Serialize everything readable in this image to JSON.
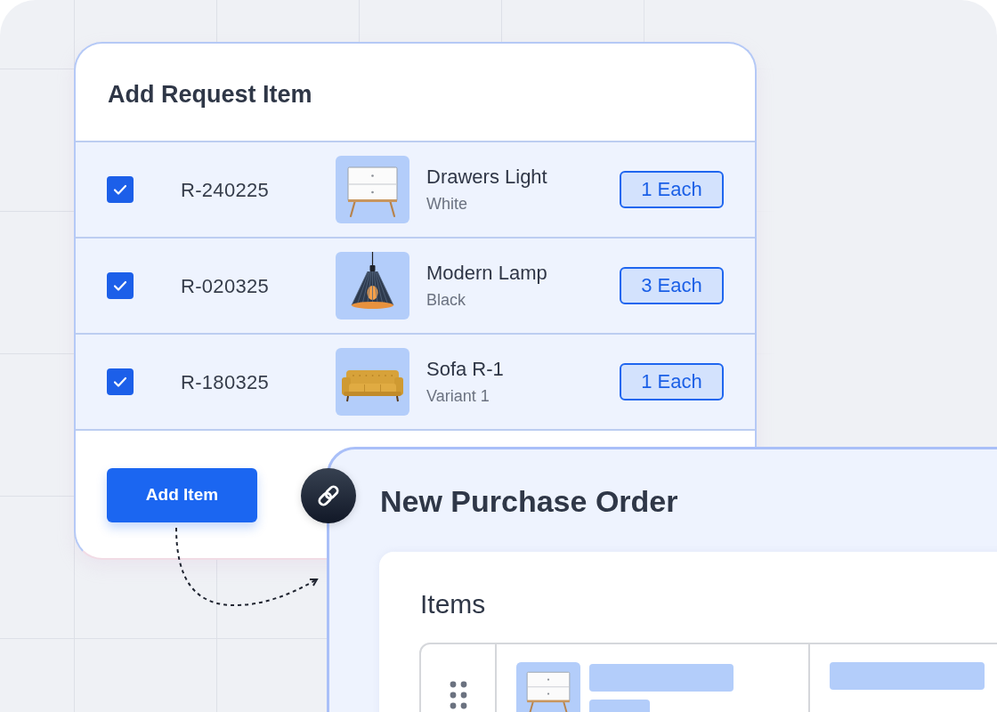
{
  "request_panel": {
    "title": "Add Request Item",
    "items": [
      {
        "checked": true,
        "request_id": "R-240225",
        "kind": "dresser",
        "name": "Drawers Light",
        "variant": "White",
        "quantity": "1 Each"
      },
      {
        "checked": true,
        "request_id": "R-020325",
        "kind": "lamp",
        "name": "Modern Lamp",
        "variant": "Black",
        "quantity": "3 Each"
      },
      {
        "checked": true,
        "request_id": "R-180325",
        "kind": "sofa",
        "name": "Sofa R-1",
        "variant": "Variant 1",
        "quantity": "1 Each"
      }
    ],
    "add_button": "Add Item"
  },
  "purchase_order": {
    "title": "New Purchase Order",
    "items_section": {
      "title": "Items",
      "rows": [
        {
          "kind": "dresser"
        }
      ]
    }
  }
}
